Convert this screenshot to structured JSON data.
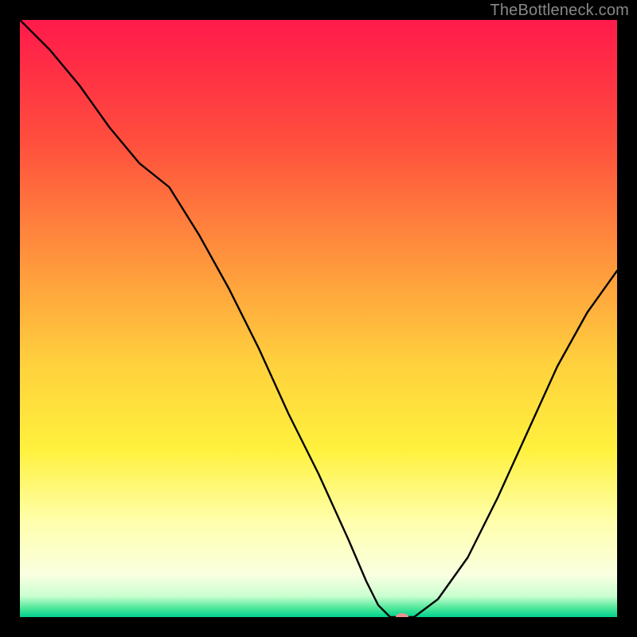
{
  "watermark": "TheBottleneck.com",
  "chart_data": {
    "type": "line",
    "title": "",
    "xlabel": "",
    "ylabel": "",
    "xlim": [
      0,
      100
    ],
    "ylim": [
      0,
      100
    ],
    "grid": false,
    "legend": false,
    "background_gradient_stops": [
      {
        "pos": 0.0,
        "color": "#ff1a4b"
      },
      {
        "pos": 0.2,
        "color": "#ff4d3d"
      },
      {
        "pos": 0.4,
        "color": "#ff943d"
      },
      {
        "pos": 0.58,
        "color": "#ffd23d"
      },
      {
        "pos": 0.72,
        "color": "#fff13d"
      },
      {
        "pos": 0.84,
        "color": "#ffffac"
      },
      {
        "pos": 0.93,
        "color": "#f9ffe0"
      },
      {
        "pos": 0.965,
        "color": "#c9ffd0"
      },
      {
        "pos": 0.985,
        "color": "#4de89a"
      },
      {
        "pos": 1.0,
        "color": "#00d18f"
      }
    ],
    "series": [
      {
        "name": "bottleneck-curve",
        "color": "#000000",
        "x": [
          0,
          5,
          10,
          15,
          20,
          25,
          30,
          35,
          40,
          45,
          50,
          55,
          58,
          60,
          62,
          64,
          66,
          70,
          75,
          80,
          85,
          90,
          95,
          100
        ],
        "y": [
          100,
          95,
          89,
          82,
          76,
          72,
          64,
          55,
          45,
          34,
          24,
          13,
          6,
          2,
          0,
          0,
          0,
          3,
          10,
          20,
          31,
          42,
          51,
          58
        ]
      }
    ],
    "marker": {
      "name": "optimal-marker",
      "x": 64,
      "y": 0,
      "color": "#e8948d",
      "rx": 8,
      "ry": 5
    }
  }
}
